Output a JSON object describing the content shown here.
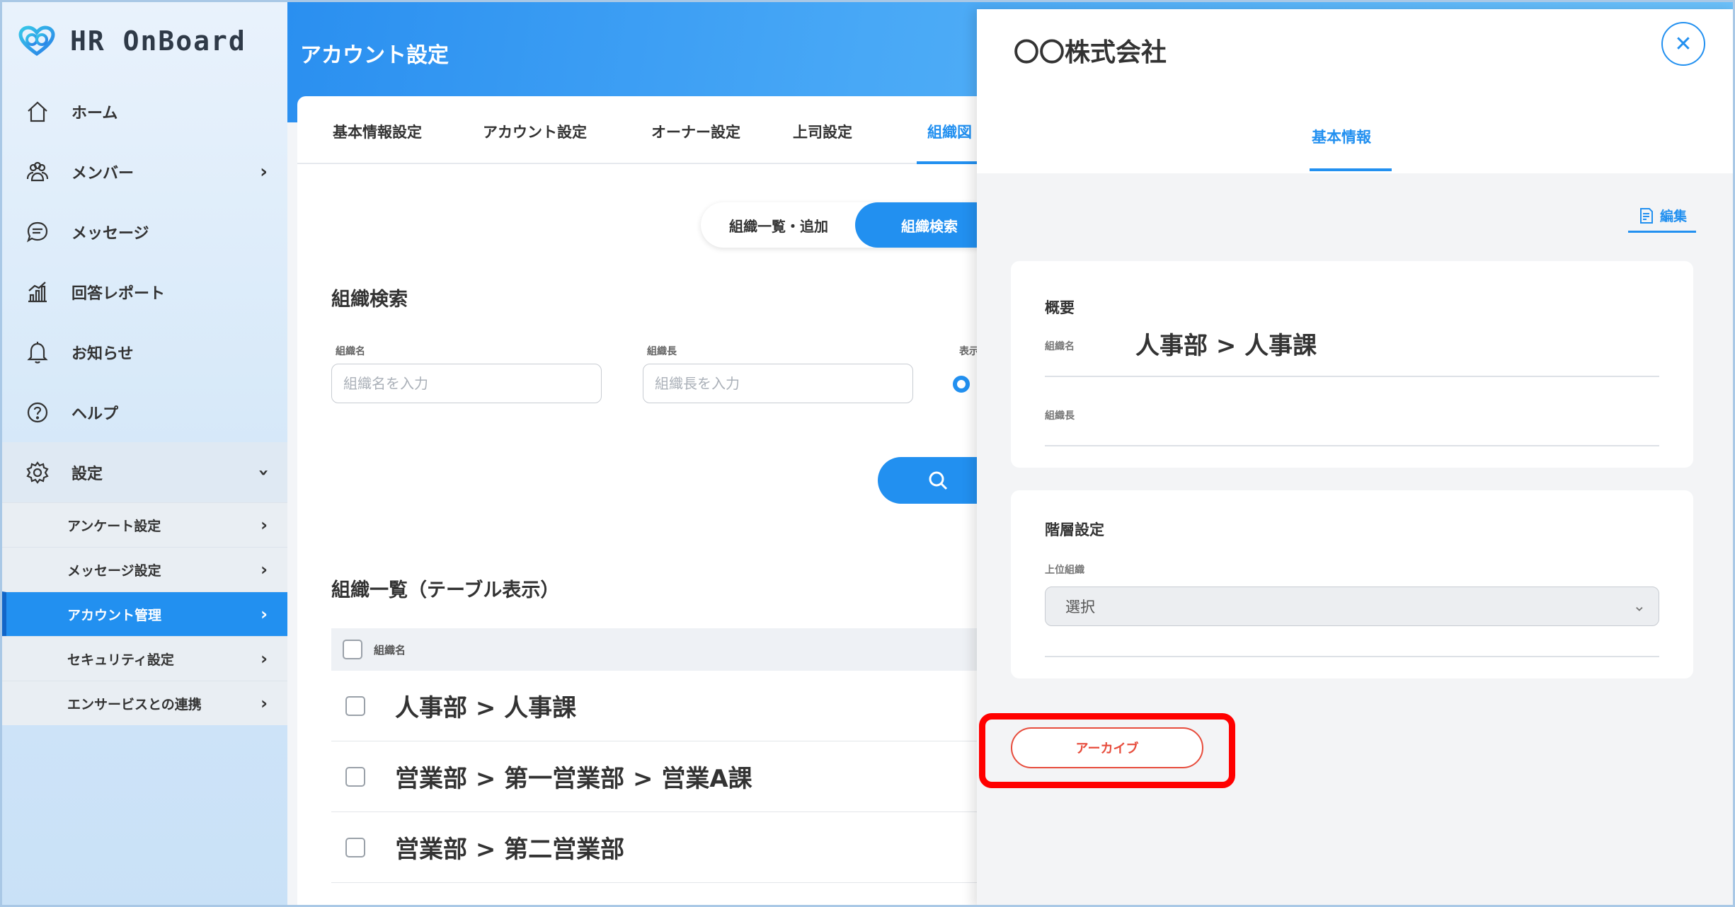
{
  "app": {
    "logo_text": "HR OnBoard"
  },
  "sidebar": {
    "items": [
      {
        "label": "ホーム",
        "icon": "home-icon"
      },
      {
        "label": "メンバー",
        "icon": "members-icon"
      },
      {
        "label": "メッセージ",
        "icon": "message-icon"
      },
      {
        "label": "回答レポート",
        "icon": "report-icon"
      },
      {
        "label": "お知らせ",
        "icon": "bell-icon"
      },
      {
        "label": "ヘルプ",
        "icon": "help-icon"
      },
      {
        "label": "設定",
        "icon": "gear-icon"
      }
    ],
    "sub_items": [
      {
        "label": "アンケート設定"
      },
      {
        "label": "メッセージ設定"
      },
      {
        "label": "アカウント管理"
      },
      {
        "label": "セキュリティ設定"
      },
      {
        "label": "エンサービスとの連携"
      }
    ]
  },
  "header": {
    "title": "アカウント設定"
  },
  "tabs": [
    "基本情報設定",
    "アカウント設定",
    "オーナー設定",
    "上司設定",
    "組織図"
  ],
  "segment": {
    "list_add": "組織一覧・追加",
    "search": "組織検索"
  },
  "search": {
    "heading": "組織検索",
    "org_name_label": "組織名",
    "org_name_placeholder": "組織名を入力",
    "org_head_label": "組織長",
    "org_head_placeholder": "組織長を入力",
    "display_label": "表示"
  },
  "list": {
    "heading": "組織一覧（テーブル表示）",
    "column": "組織名",
    "rows": [
      "人事部 > 人事課",
      "営業部 > 第一営業部 > 営業A課",
      "営業部 > 第二営業部"
    ]
  },
  "drawer": {
    "title": "〇〇株式会社",
    "tab": "基本情報",
    "edit_label": "編集",
    "overview": {
      "heading": "概要",
      "org_name_label": "組織名",
      "org_name_value": "人事部 > 人事課",
      "org_head_label": "組織長"
    },
    "hierarchy": {
      "heading": "階層設定",
      "parent_label": "上位組織",
      "select_value": "選択"
    },
    "archive_label": "アーカイブ"
  },
  "colors": {
    "accent": "#2290f0",
    "danger": "#e74c3c",
    "highlight": "#ff0000"
  }
}
